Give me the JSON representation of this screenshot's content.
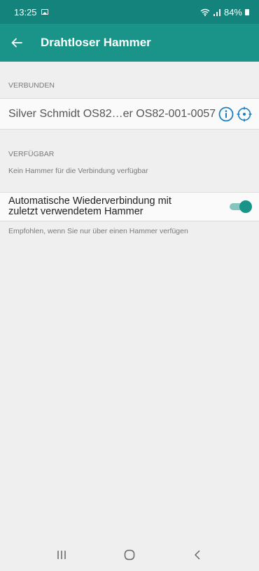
{
  "status_bar": {
    "time": "13:25",
    "battery": "84%",
    "icons": [
      "gallery-icon",
      "wifi-icon",
      "signal-icon",
      "battery-icon"
    ]
  },
  "app_bar": {
    "title": "Drahtloser Hammer",
    "back_icon": "arrow-left-icon",
    "background": "#1a9489"
  },
  "connected": {
    "header": "VERBUNDEN",
    "device_name": "Silver Schmidt OS82…er OS82-001-0057",
    "icons": [
      "info-icon",
      "locate-icon"
    ]
  },
  "available": {
    "header": "VERFÜGBAR",
    "hint": "Kein Hammer für die Verbindung verfügbar"
  },
  "auto_reconnect": {
    "label_line1": "Automatische Wiederverbindung mit",
    "label_line2": "zuletzt verwendetem Hammer",
    "enabled": true,
    "note": "Empfohlen, wenn Sie nur über einen Hammer verfügen"
  },
  "nav_bar": {
    "buttons": [
      "recents-icon",
      "home-icon",
      "back-icon"
    ]
  },
  "colors": {
    "status_bar": "#14837b",
    "accent": "#1a9489",
    "background": "#efefef"
  }
}
